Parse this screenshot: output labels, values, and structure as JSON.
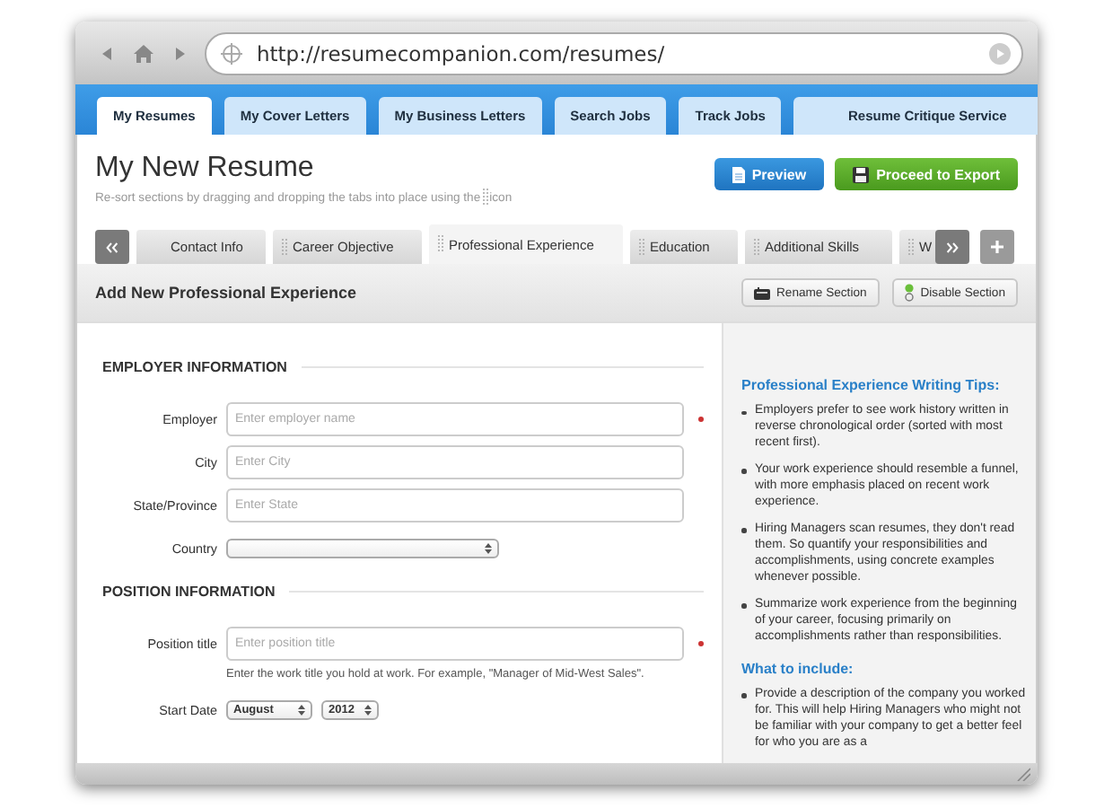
{
  "browser": {
    "url": "http://resumecompanion.com/resumes/"
  },
  "nav_tabs": [
    {
      "label": "My Resumes",
      "selected": true,
      "kind": "main"
    },
    {
      "label": "My Cover Letters",
      "selected": false,
      "kind": "main"
    },
    {
      "label": "My Business Letters",
      "selected": false,
      "kind": "main"
    },
    {
      "label": "Search Jobs",
      "selected": false,
      "kind": "main"
    },
    {
      "label": "Track Jobs",
      "selected": false,
      "kind": "main"
    },
    {
      "label": "Resume Critique Service",
      "selected": false,
      "kind": "service"
    }
  ],
  "page": {
    "title": "My New Resume",
    "hint_before": "Re-sort sections by dragging and dropping the tabs into place using the",
    "hint_after": "icon"
  },
  "actions": [
    {
      "label": "Preview",
      "kind": "preview"
    },
    {
      "label": "Proceed to Export",
      "kind": "export"
    }
  ],
  "section_tabs": [
    {
      "label": "Contact Info",
      "selected": false
    },
    {
      "label": "Career Objective",
      "selected": false
    },
    {
      "label": "Professional Experience",
      "selected": true
    },
    {
      "label": "Education",
      "selected": false
    },
    {
      "label": "Additional Skills",
      "selected": false
    },
    {
      "label": "W",
      "selected": false
    }
  ],
  "section": {
    "title": "Add New Professional Experience",
    "buttons": [
      {
        "label": "Rename Section",
        "kind": "rename"
      },
      {
        "label": "Disable Section",
        "kind": "disable"
      }
    ]
  },
  "form_groups": [
    {
      "heading": "EMPLOYER INFORMATION",
      "fields": [
        {
          "label": "Employer",
          "kind": "text",
          "placeholder": "Enter employer name",
          "required": true
        },
        {
          "label": "City",
          "kind": "text",
          "placeholder": "Enter City",
          "required": false
        },
        {
          "label": "State/Province",
          "kind": "text",
          "placeholder": "Enter State",
          "required": false
        },
        {
          "label": "Country",
          "kind": "select"
        }
      ]
    },
    {
      "heading": "POSITION INFORMATION",
      "fields": [
        {
          "label": "Position title",
          "kind": "text",
          "placeholder": "Enter position title",
          "required": true,
          "help": "Enter the work title you hold at work. For example, \"Manager of Mid-West Sales\"."
        },
        {
          "label": "Start Date",
          "kind": "date",
          "month": "August",
          "year": "2012"
        }
      ]
    }
  ],
  "tips": [
    {
      "heading": "Professional Experience Writing Tips:",
      "items": [
        "Employers prefer to see work history written in reverse chronological order (sorted with most recent first).",
        "Your work experience should resemble a funnel, with more emphasis placed on recent work experience.",
        "Hiring Managers scan resumes, they don't read them. So quantify your responsibilities and accomplishments, using concrete examples whenever possible.",
        "Summarize work experience from the beginning of your career, focusing primarily on accomplishments rather than responsibilities."
      ]
    },
    {
      "heading": "What to include:",
      "items": [
        "Provide a description of the company you worked for. This will help Hiring Managers who might not be familiar with your company to get a better feel for who you are as a"
      ]
    }
  ]
}
